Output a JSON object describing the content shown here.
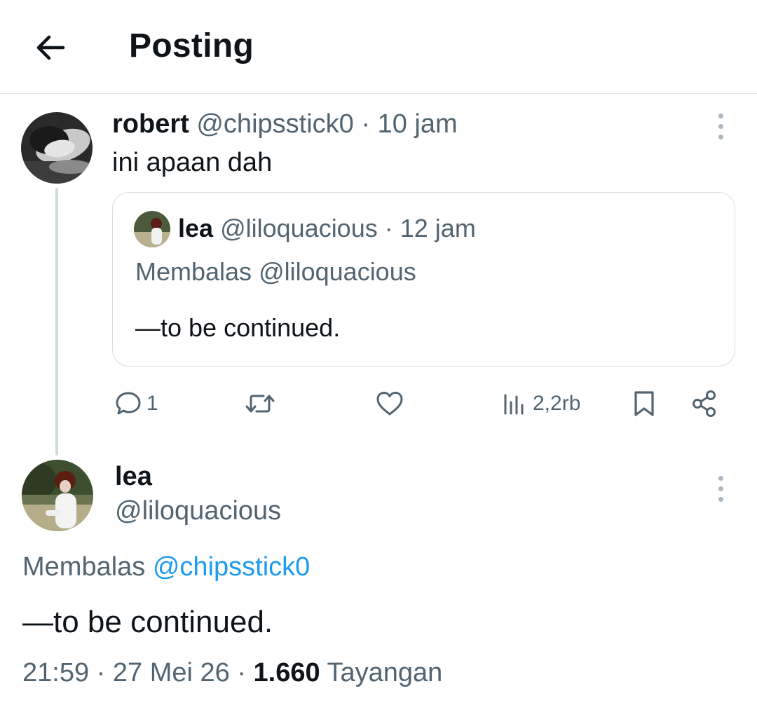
{
  "header": {
    "title": "Posting",
    "back_icon": "arrow-left-icon"
  },
  "reply_post": {
    "author_name": "robert",
    "author_handle": "@chipsstick0",
    "separator": "·",
    "time": "10 jam",
    "text": "ini apaan dah",
    "quote": {
      "author_name": "lea",
      "author_handle": "@liloquacious",
      "separator": "·",
      "time": "12 jam",
      "replying_to": "Membalas @liloquacious",
      "text": "—to be continued."
    },
    "actions": {
      "reply_count": "1",
      "views": "2,2rb"
    }
  },
  "main_post": {
    "author_name": "lea",
    "author_handle": "@liloquacious",
    "replying_label": "Membalas",
    "replying_handle": "@chipsstick0",
    "text": "—to be continued.",
    "meta_time": "21:59",
    "separator": "·",
    "meta_date": "27 Mei 26",
    "views_count": "1.660",
    "views_label": "Tayangan"
  },
  "colors": {
    "text": "#0f1419",
    "secondary": "#536471",
    "link": "#1d9bf0",
    "border": "#d7dee3"
  }
}
